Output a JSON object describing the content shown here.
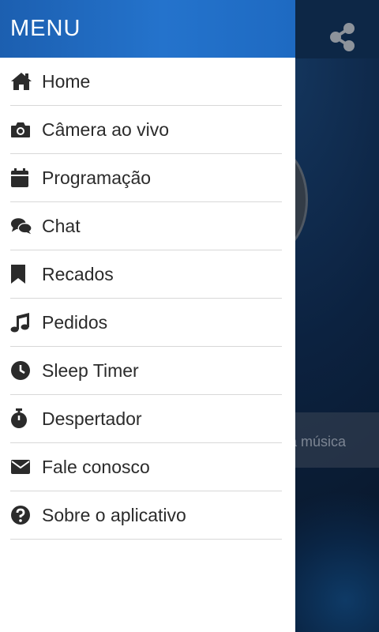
{
  "drawer": {
    "title": "MENU",
    "items": [
      {
        "label": "Home",
        "icon": "home-icon"
      },
      {
        "label": "Câmera ao vivo",
        "icon": "camera-icon"
      },
      {
        "label": "Programação",
        "icon": "calendar-icon"
      },
      {
        "label": "Chat",
        "icon": "chat-icon"
      },
      {
        "label": "Recados",
        "icon": "bookmark-icon"
      },
      {
        "label": "Pedidos",
        "icon": "music-icon"
      },
      {
        "label": "Sleep Timer",
        "icon": "clock-icon"
      },
      {
        "label": "Despertador",
        "icon": "stopwatch-icon"
      },
      {
        "label": "Fale conosco",
        "icon": "envelope-icon"
      },
      {
        "label": "Sobre o aplicativo",
        "icon": "question-icon"
      }
    ]
  },
  "background": {
    "share_icon": "share-icon",
    "bar_text": "a música"
  },
  "colors": {
    "header": "#2473cc",
    "icon": "#2b2b2b",
    "text": "#2b2b2b",
    "divider": "#d8d8d8"
  }
}
